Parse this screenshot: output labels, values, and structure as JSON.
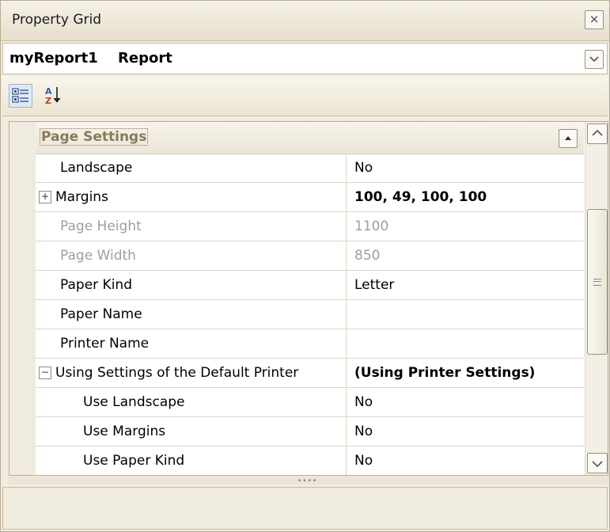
{
  "window": {
    "title": "Property Grid",
    "close_glyph": "×"
  },
  "selector": {
    "object_name": "myReport1",
    "object_type": "Report"
  },
  "toolbar": {
    "categorized_icon": "categorized-view-icon",
    "alphabetical_icon": "sort-az-icon",
    "alphabetical_glyph_a": "A",
    "alphabetical_glyph_z": "Z"
  },
  "category": {
    "label": "Page Settings"
  },
  "rows": [
    {
      "name": "Landscape",
      "value": "No"
    },
    {
      "name": "Margins",
      "value": "100, 49, 100, 100",
      "expander": "+"
    },
    {
      "name": "Page Height",
      "value": "1100"
    },
    {
      "name": "Page Width",
      "value": "850"
    },
    {
      "name": "Paper Kind",
      "value": "Letter"
    },
    {
      "name": "Paper Name",
      "value": ""
    },
    {
      "name": "Printer Name",
      "value": ""
    },
    {
      "name": "Using Settings of the Default Printer",
      "value": "(Using Printer Settings)",
      "expander": "−"
    },
    {
      "name": "Use Landscape",
      "value": "No"
    },
    {
      "name": "Use Margins",
      "value": "No"
    },
    {
      "name": "Use Paper Kind",
      "value": "No"
    }
  ],
  "splitter": {
    "grip": "••••"
  },
  "colors": {
    "accent": "#8a7a58",
    "background": "#f1ece0",
    "border": "#b8ab92"
  }
}
